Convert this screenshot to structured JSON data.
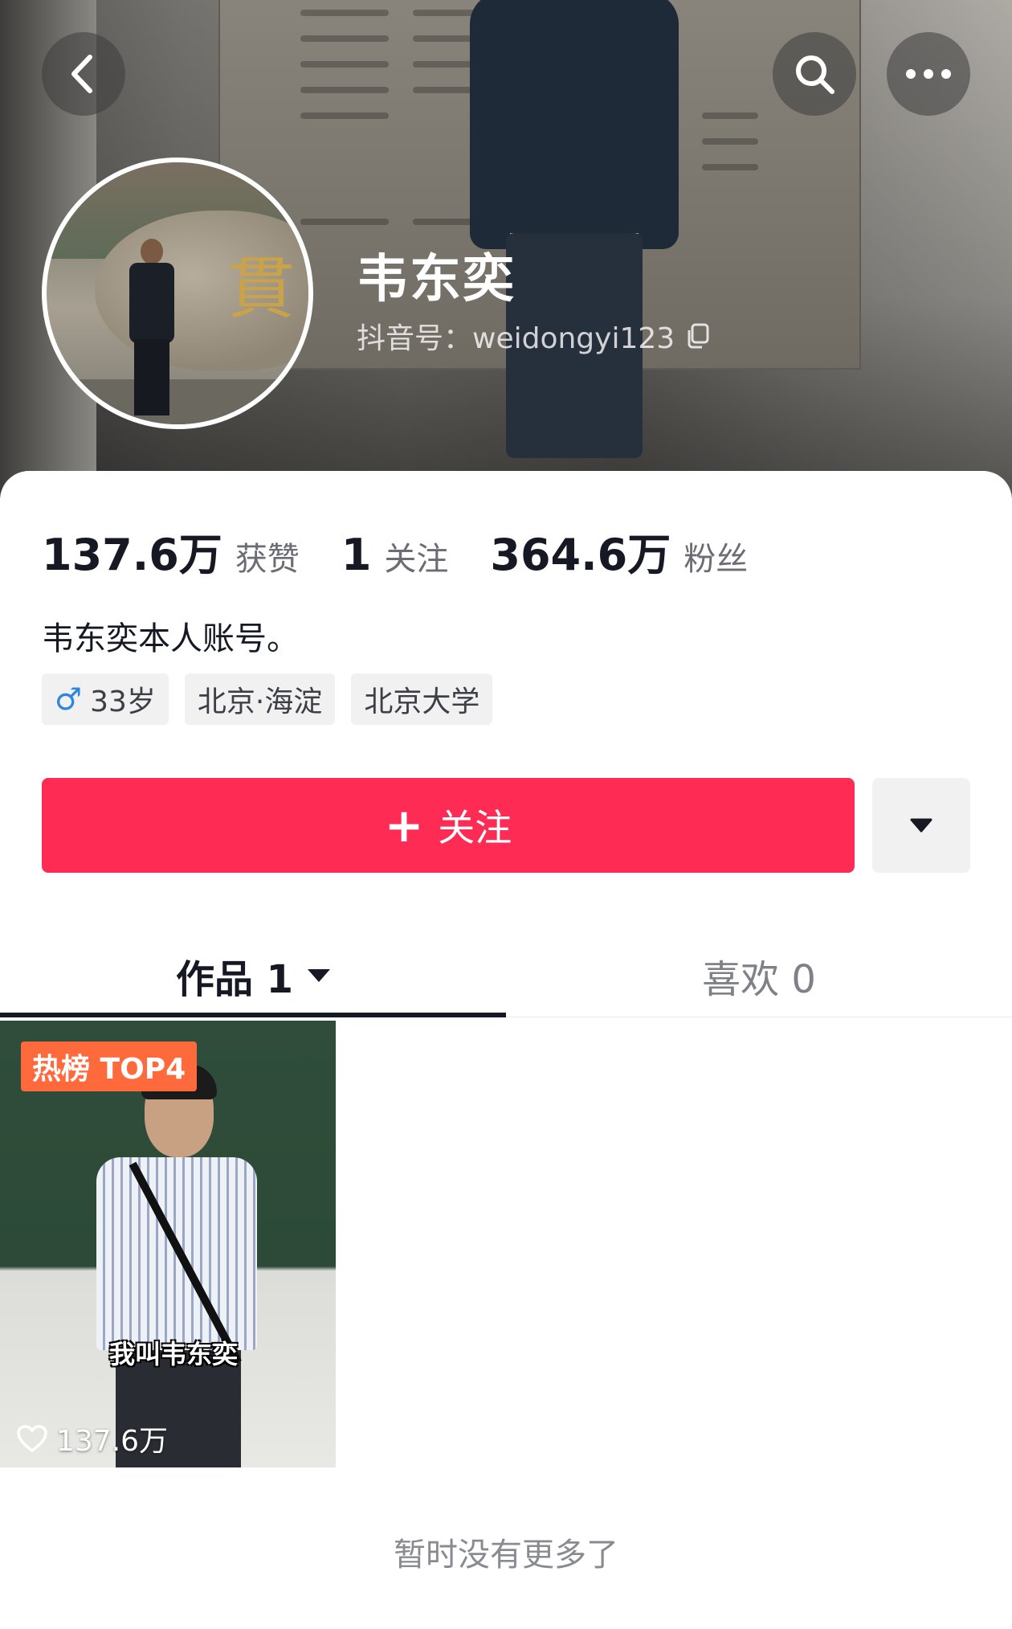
{
  "header": {
    "username": "韦东奕",
    "douyin_id": "抖音号：weidongyi123",
    "icons": {
      "back": "back-arrow-icon",
      "search": "search-icon",
      "more": "more-dots-icon",
      "copy": "copy-icon"
    }
  },
  "stats": {
    "likes": {
      "value": "137.6万",
      "label": "获赞"
    },
    "following": {
      "value": "1",
      "label": "关注"
    },
    "followers": {
      "value": "364.6万",
      "label": "粉丝"
    }
  },
  "bio": "韦东奕本人账号。",
  "tags": {
    "age": "33岁",
    "location": "北京·海淀",
    "school": "北京大学"
  },
  "actions": {
    "follow_label": "关注",
    "accent_color": "#fe2c55"
  },
  "tabs": {
    "works": "作品 1",
    "likes": "喜欢 0"
  },
  "video": {
    "badge": "热榜 TOP4",
    "caption": "我叫韦东奕",
    "likes": "137.6万"
  },
  "footer": {
    "no_more": "暂时没有更多了"
  }
}
